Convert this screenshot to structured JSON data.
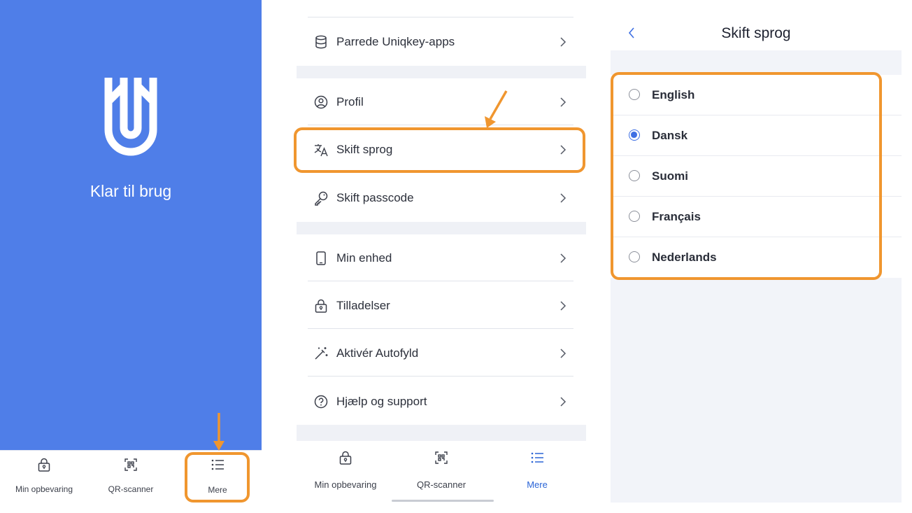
{
  "colors": {
    "brand_blue": "#4f7ee8",
    "active_blue": "#2a64d6",
    "highlight_orange": "#f0962f",
    "separator": "#eff1f6"
  },
  "splash": {
    "logo_icon": "uniqkey-logo",
    "status_text": "Klar til brug"
  },
  "tabbar": {
    "items": [
      {
        "label": "Min opbevaring",
        "icon": "lock-icon"
      },
      {
        "label": "QR-scanner",
        "icon": "qr-scan-icon"
      },
      {
        "label": "Mere",
        "icon": "list-icon"
      }
    ],
    "active_in_menu_screen": "Mere"
  },
  "menu": {
    "items": [
      {
        "label": "Parrede Uniqkey-apps",
        "icon": "database-icon"
      },
      {
        "label": "Profil",
        "icon": "user-circle-icon"
      },
      {
        "label": "Skift sprog",
        "icon": "translate-icon"
      },
      {
        "label": "Skift passcode",
        "icon": "key-icon"
      },
      {
        "label": "Min enhed",
        "icon": "phone-icon"
      },
      {
        "label": "Tilladelser",
        "icon": "lock-icon"
      },
      {
        "label": "Aktivér Autofyld",
        "icon": "magic-wand-icon"
      },
      {
        "label": "Hjælp og support",
        "icon": "help-circle-icon"
      }
    ]
  },
  "language_screen": {
    "title": "Skift sprog",
    "back_icon": "chevron-left-icon",
    "options": [
      {
        "label": "English",
        "selected": false
      },
      {
        "label": "Dansk",
        "selected": true
      },
      {
        "label": "Suomi",
        "selected": false
      },
      {
        "label": "Français",
        "selected": false
      },
      {
        "label": "Nederlands",
        "selected": false
      }
    ]
  }
}
